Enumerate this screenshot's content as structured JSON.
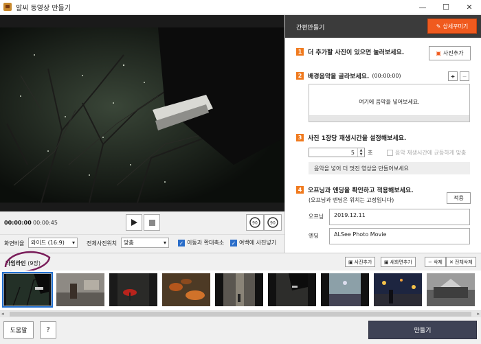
{
  "window": {
    "title": "알씨 동영상 만들기",
    "minimize": "—",
    "maximize": "☐",
    "close": "✕"
  },
  "player": {
    "current_time": "00:00:00",
    "total_time": "00:00:45",
    "rotate_left": "90",
    "rotate_right": "90"
  },
  "options": {
    "ratio_label": "화면비율",
    "ratio_value": "와이드 (16:9)",
    "position_label": "전체사진위치",
    "position_value": "맞춤",
    "move_zoom_label": "이동과 확대축소",
    "move_zoom_checked": true,
    "margin_label": "여백에 사진넣기",
    "margin_checked": true
  },
  "panel": {
    "title": "간편만들기",
    "detail_button": "상세꾸미기",
    "step1": {
      "num": "1",
      "text": "더 추가할 사진이 있으면 눌러보세요.",
      "button": "사진추가"
    },
    "step2": {
      "num": "2",
      "text": "배경음악을 골라보세요.",
      "sub": "(00:00:00)",
      "add": "+",
      "remove": "−",
      "empty_msg": "여기에 음악을 넣어보세요."
    },
    "step3": {
      "num": "3",
      "text": "사진 1장당 재생시간을 설정해보세요.",
      "seconds": "5",
      "unit": "초",
      "sync_label": "음악 재생시간에 균등하게 맞춤",
      "hint": "음악을 넣어 더 멋진 영상을 만들어보세요"
    },
    "step4": {
      "num": "4",
      "text": "오프닝과 엔딩을 확인하고 적용해보세요.",
      "sub": "(오프닝과 엔딩은 위치는 고정입니다)",
      "apply": "적용",
      "opening_label": "오프닝",
      "opening_value": "2019.12.11",
      "ending_label": "엔딩",
      "ending_value": "ALSee Photo Movie"
    }
  },
  "timeline": {
    "title": "타임라인",
    "count": "(9장)",
    "add_photo": "사진추가",
    "new_screen": "새화면추가",
    "delete": "삭제",
    "delete_all": "전체삭제",
    "thumbnails": [
      "photo-1",
      "photo-2",
      "photo-3",
      "photo-4",
      "photo-5",
      "photo-6",
      "photo-7",
      "photo-8",
      "photo-9"
    ]
  },
  "footer": {
    "help": "도움말",
    "question": "?",
    "make": "만들기"
  }
}
